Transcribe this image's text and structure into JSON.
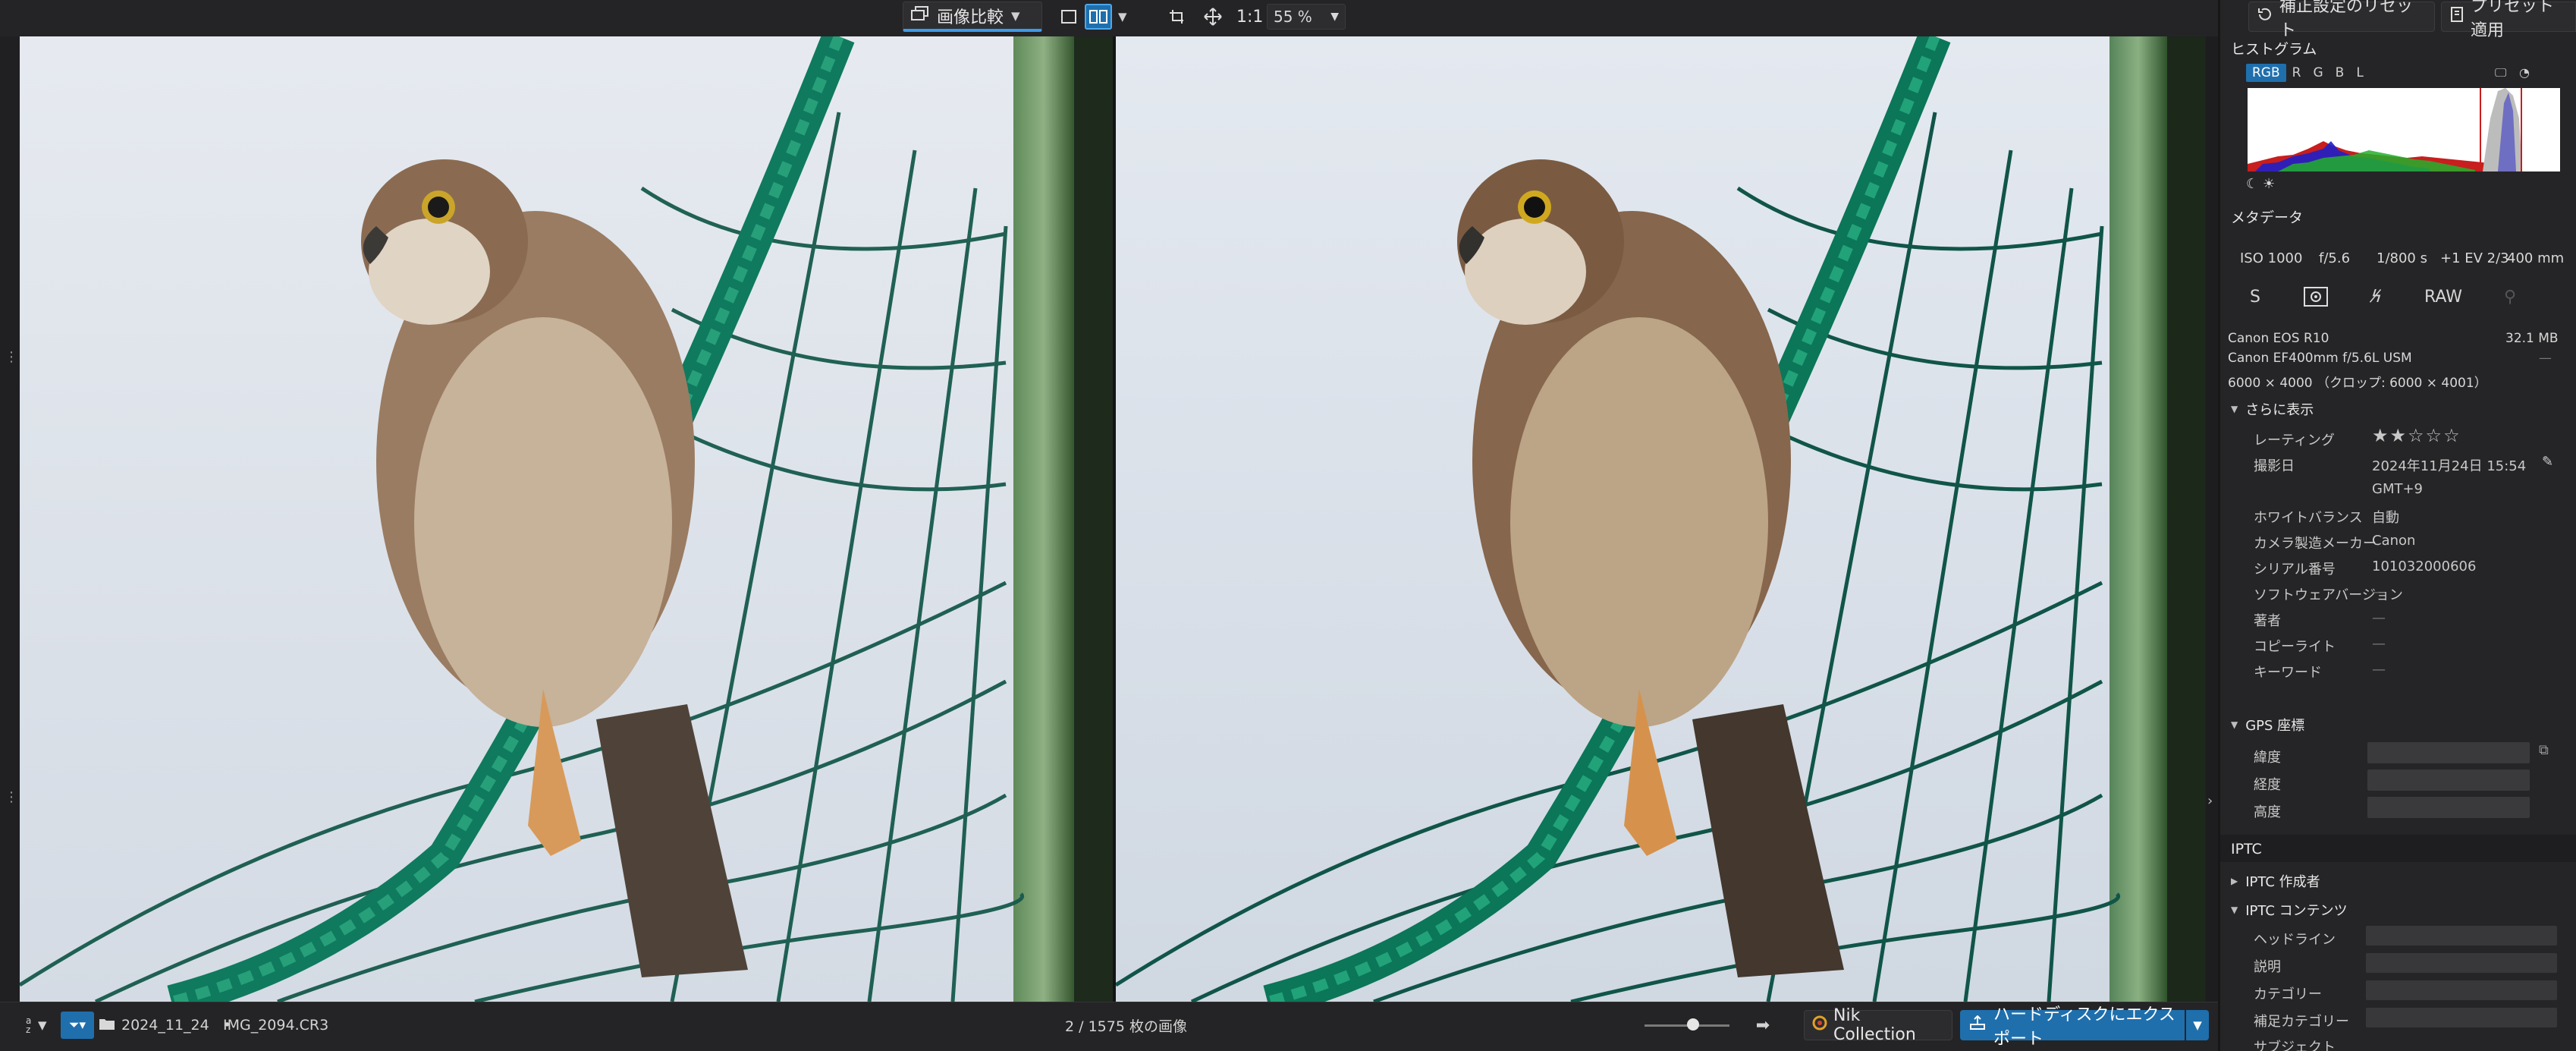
{
  "toolbar": {
    "compare_label": "画像比較",
    "one_to_one": "1:1",
    "zoom": "55 %",
    "reset_label": "補正設定のリセット",
    "preset_label": "プリセット適用"
  },
  "status": {
    "sort_icon_text": "a z",
    "folder": "2024_11_24",
    "separator": "•",
    "file": "IMG_2094.CR3",
    "count": "2 / 1575 枚の画像",
    "nik_label": "Nik Collection",
    "export_label": "ハードディスクにエクスポート"
  },
  "panel": {
    "histogram_title": "ヒストグラム",
    "histogram_tabs": [
      "RGB",
      "R",
      "G",
      "B",
      "L"
    ],
    "metadata_title": "メタデータ",
    "exif": {
      "iso": "ISO 1000",
      "aperture": "f/5.6",
      "shutter": "1/800 s",
      "ev": "+1 EV 2/3",
      "focal": "400 mm"
    },
    "mode_s": "S",
    "raw_label": "RAW",
    "camera": "Canon EOS R10",
    "filesize": "32.1 MB",
    "lens": "Canon EF400mm f/5.6L USM",
    "lens_extra": "—",
    "dimensions": "6000 × 4000 （クロップ: 6000 × 4001）",
    "more_label": "さらに表示",
    "fields": [
      {
        "label": "レーティング",
        "value": "★★☆☆☆"
      },
      {
        "label": "撮影日",
        "value": "2024年11月24日 15:54"
      },
      {
        "label": "",
        "value": "GMT+9"
      },
      {
        "label": "ホワイトバランス",
        "value": "自動"
      },
      {
        "label": "カメラ製造メーカー",
        "value": "Canon"
      },
      {
        "label": "シリアル番号",
        "value": "101032000606"
      },
      {
        "label": "ソフトウェアバージョン",
        "value": "—"
      },
      {
        "label": "著者",
        "value": "—"
      },
      {
        "label": "コピーライト",
        "value": "—"
      },
      {
        "label": "キーワード",
        "value": "—"
      }
    ],
    "gps_title": "GPS 座標",
    "gps_fields": [
      "緯度",
      "経度",
      "高度"
    ],
    "iptc_title": "IPTC",
    "iptc_creator": "IPTC 作成者",
    "iptc_content": "IPTC コンテンツ",
    "iptc_fields": [
      "ヘッドライン",
      "説明",
      "カテゴリー",
      "補足カテゴリー",
      "サブジェクト"
    ]
  },
  "colors": {
    "accent": "#1f6fad",
    "panel_bg": "#252527",
    "sky": "#dfe4ea",
    "net": "#0f7a5e"
  }
}
